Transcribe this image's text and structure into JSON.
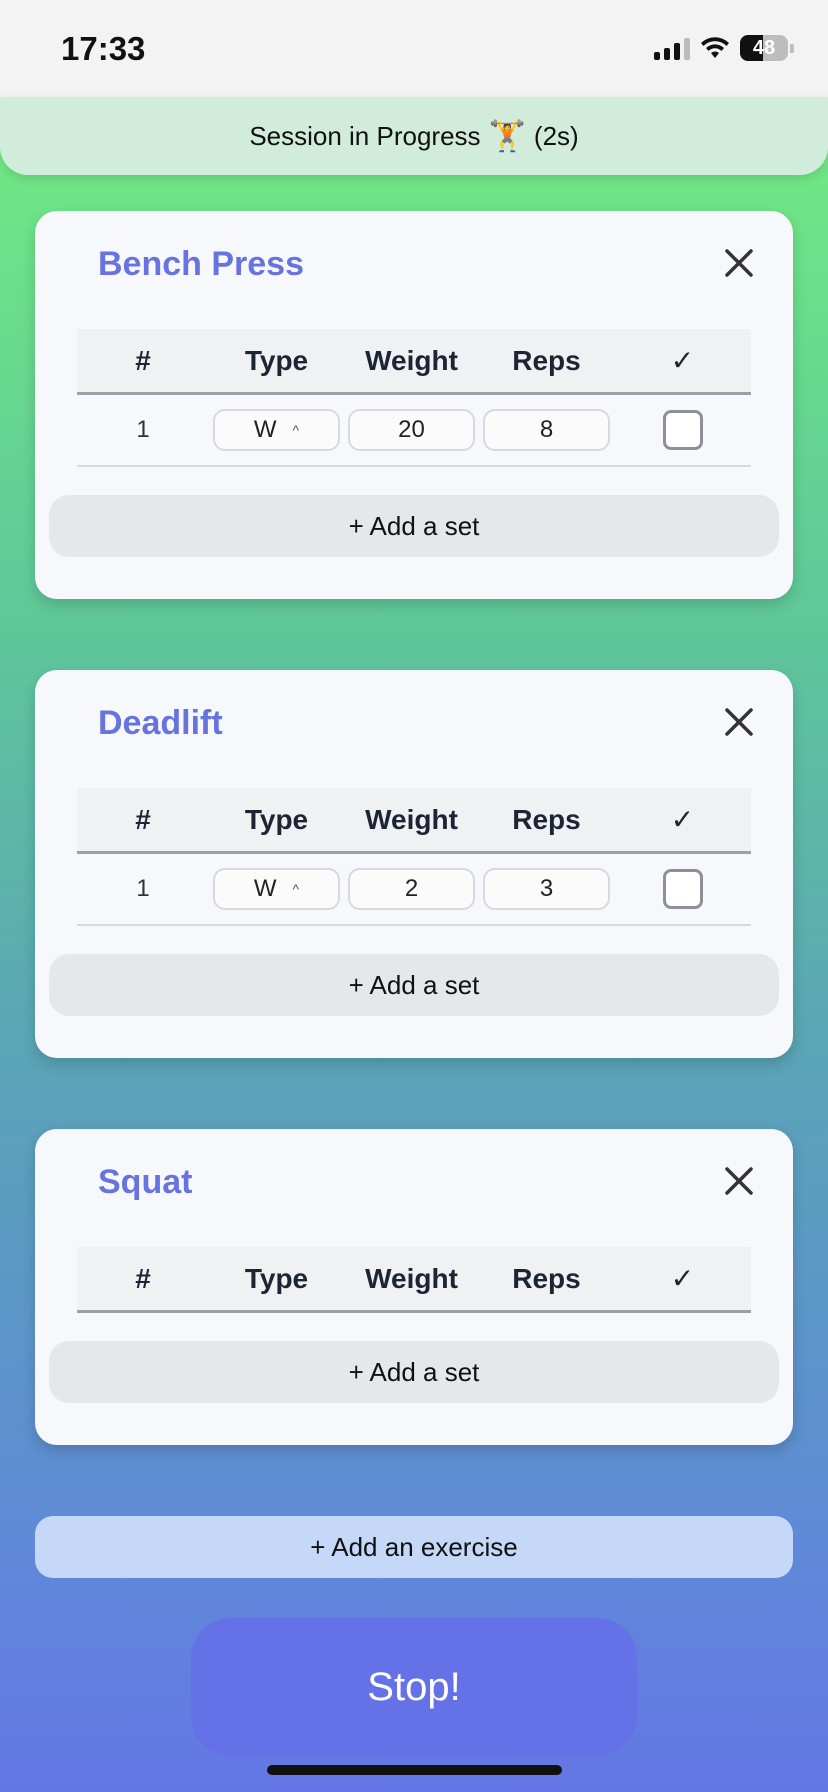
{
  "status_bar": {
    "time": "17:33",
    "battery": "48"
  },
  "session": {
    "label": "Session in Progress",
    "emoji": "🏋️",
    "elapsed": "(2s)"
  },
  "table_headers": {
    "num": "#",
    "type": "Type",
    "weight": "Weight",
    "reps": "Reps",
    "done": "✓"
  },
  "exercises": [
    {
      "name": "Bench Press",
      "sets": [
        {
          "num": "1",
          "type": "W",
          "weight": "20",
          "reps": "8",
          "done": false
        }
      ],
      "add_set_label": "+ Add a set"
    },
    {
      "name": "Deadlift",
      "sets": [
        {
          "num": "1",
          "type": "W",
          "weight": "2",
          "reps": "3",
          "done": false
        }
      ],
      "add_set_label": "+ Add a set"
    },
    {
      "name": "Squat",
      "sets": [],
      "add_set_label": "+ Add a set"
    }
  ],
  "add_exercise_label": "+ Add an exercise",
  "stop_label": "Stop!",
  "colors": {
    "accent": "#6773de",
    "stop": "#6571e6",
    "banner": "#d2ecdc"
  }
}
